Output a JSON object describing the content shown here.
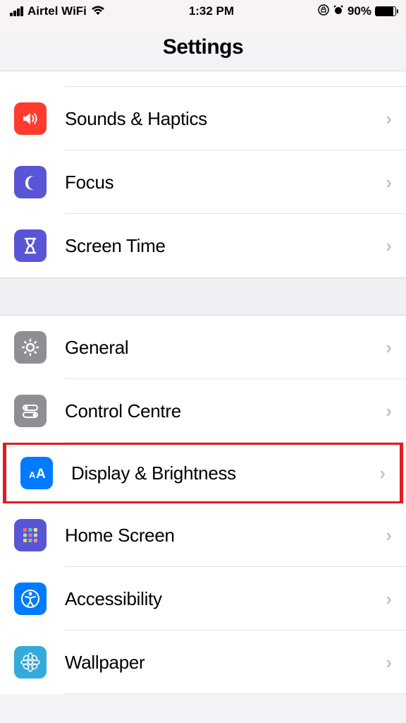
{
  "statusBar": {
    "carrier": "Airtel WiFi",
    "time": "1:32 PM",
    "batteryPercent": "90%"
  },
  "header": {
    "title": "Settings"
  },
  "section1": {
    "items": [
      {
        "label": "Sounds & Haptics",
        "icon": "speaker-icon",
        "color": "bg-red"
      },
      {
        "label": "Focus",
        "icon": "moon-icon",
        "color": "bg-indigo"
      },
      {
        "label": "Screen Time",
        "icon": "hourglass-icon",
        "color": "bg-indigo"
      }
    ]
  },
  "section2": {
    "items": [
      {
        "label": "General",
        "icon": "gear-icon",
        "color": "bg-gray"
      },
      {
        "label": "Control Centre",
        "icon": "toggles-icon",
        "color": "bg-gray"
      },
      {
        "label": "Display & Brightness",
        "icon": "textsize-icon",
        "color": "bg-blue",
        "highlighted": true
      },
      {
        "label": "Home Screen",
        "icon": "apps-icon",
        "color": "bg-indigo"
      },
      {
        "label": "Accessibility",
        "icon": "accessibility-icon",
        "color": "bg-blue"
      },
      {
        "label": "Wallpaper",
        "icon": "flower-icon",
        "color": "bg-lightblue"
      }
    ]
  }
}
